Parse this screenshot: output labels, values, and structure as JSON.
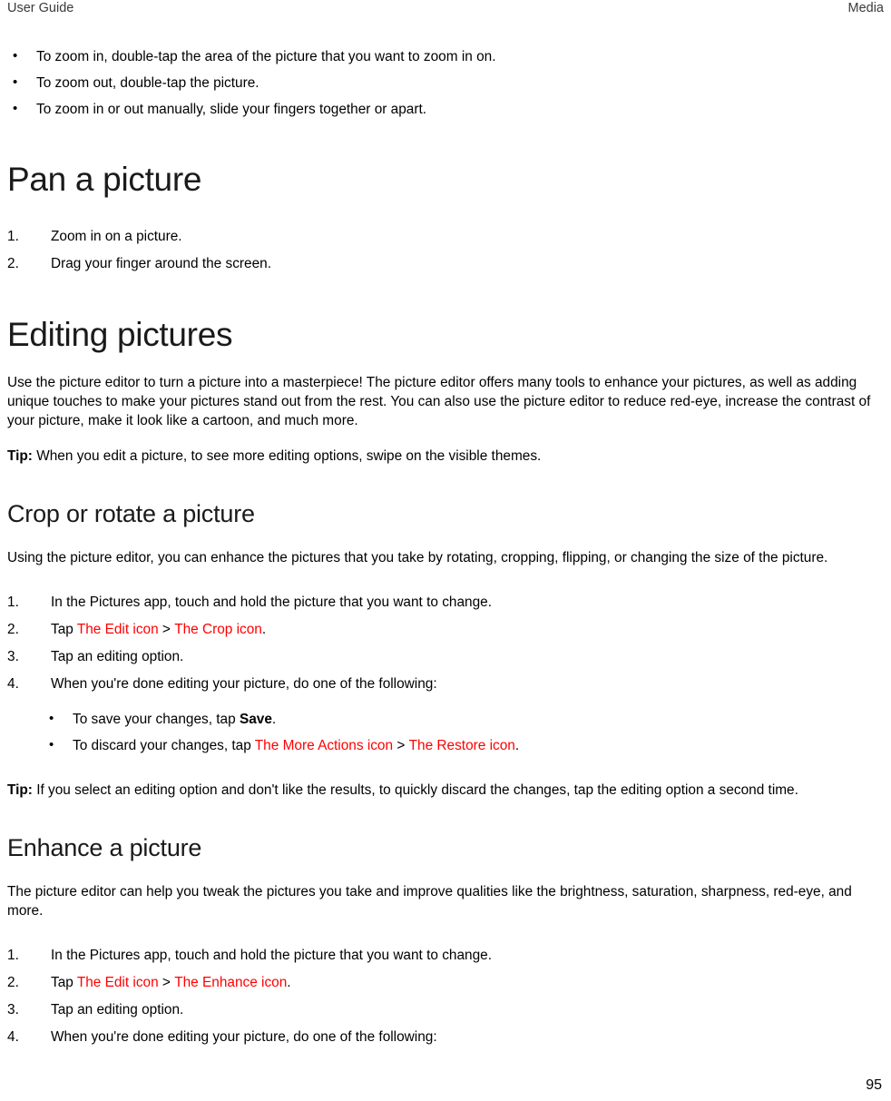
{
  "header": {
    "left": "User Guide",
    "right": "Media"
  },
  "zoom_bullets": [
    "To zoom in, double-tap the area of the picture that you want to zoom in on.",
    "To zoom out, double-tap the picture.",
    "To zoom in or out manually, slide your fingers together or apart."
  ],
  "pan_section": {
    "title": "Pan a picture",
    "steps": [
      "Zoom in on a picture.",
      "Drag your finger around the screen."
    ]
  },
  "editing_section": {
    "title": "Editing pictures",
    "intro": "Use the picture editor to turn a picture into a masterpiece! The picture editor offers many tools to enhance your pictures, as well as adding unique touches to make your pictures stand out from the rest. You can also use the picture editor to reduce red-eye, increase the contrast of your picture, make it look like a cartoon, and much more.",
    "tip_label": "Tip:",
    "tip_text": " When you edit a picture, to see more editing options, swipe on the visible themes."
  },
  "crop_section": {
    "title": "Crop or rotate a picture",
    "intro": "Using the picture editor, you can enhance the pictures that you take by rotating, cropping, flipping, or changing the size of the picture.",
    "step1": "In the Pictures app, touch and hold the picture that you want to change.",
    "step2_prefix": "Tap ",
    "step2_icon1": "The Edit icon",
    "step2_separator": ">",
    "step2_icon2": "The Crop icon",
    "step2_suffix": ".",
    "step3": "Tap an editing option.",
    "step4": "When you're done editing your picture, do one of the following:",
    "save_bullet_prefix": " To save your changes, tap ",
    "save_bullet_bold": "Save",
    "save_bullet_suffix": ".",
    "discard_bullet_prefix": "To discard your changes, tap ",
    "discard_icon1": "The More Actions icon",
    "discard_separator": ">",
    "discard_icon2": "The Restore icon",
    "discard_suffix": ".",
    "tip_label": "Tip:",
    "tip_text": " If you select an editing option and don't like the results, to quickly discard the changes, tap the editing option a second time."
  },
  "enhance_section": {
    "title": "Enhance a picture",
    "intro": "The picture editor can help you tweak the pictures you take and improve qualities like the brightness, saturation, sharpness, red-eye, and more.",
    "step1": "In the Pictures app, touch and hold the picture that you want to change.",
    "step2_prefix": "Tap ",
    "step2_icon1": "The Edit icon",
    "step2_separator": ">",
    "step2_icon2": "The Enhance icon",
    "step2_suffix": ".",
    "step3": "Tap an editing option.",
    "step4": "When you're done editing your picture, do one of the following:"
  },
  "footer": {
    "page_number": "95"
  },
  "colors": {
    "icon_link_red": "#ff0000",
    "text": "#000000",
    "header_text": "#3a3a3a"
  }
}
